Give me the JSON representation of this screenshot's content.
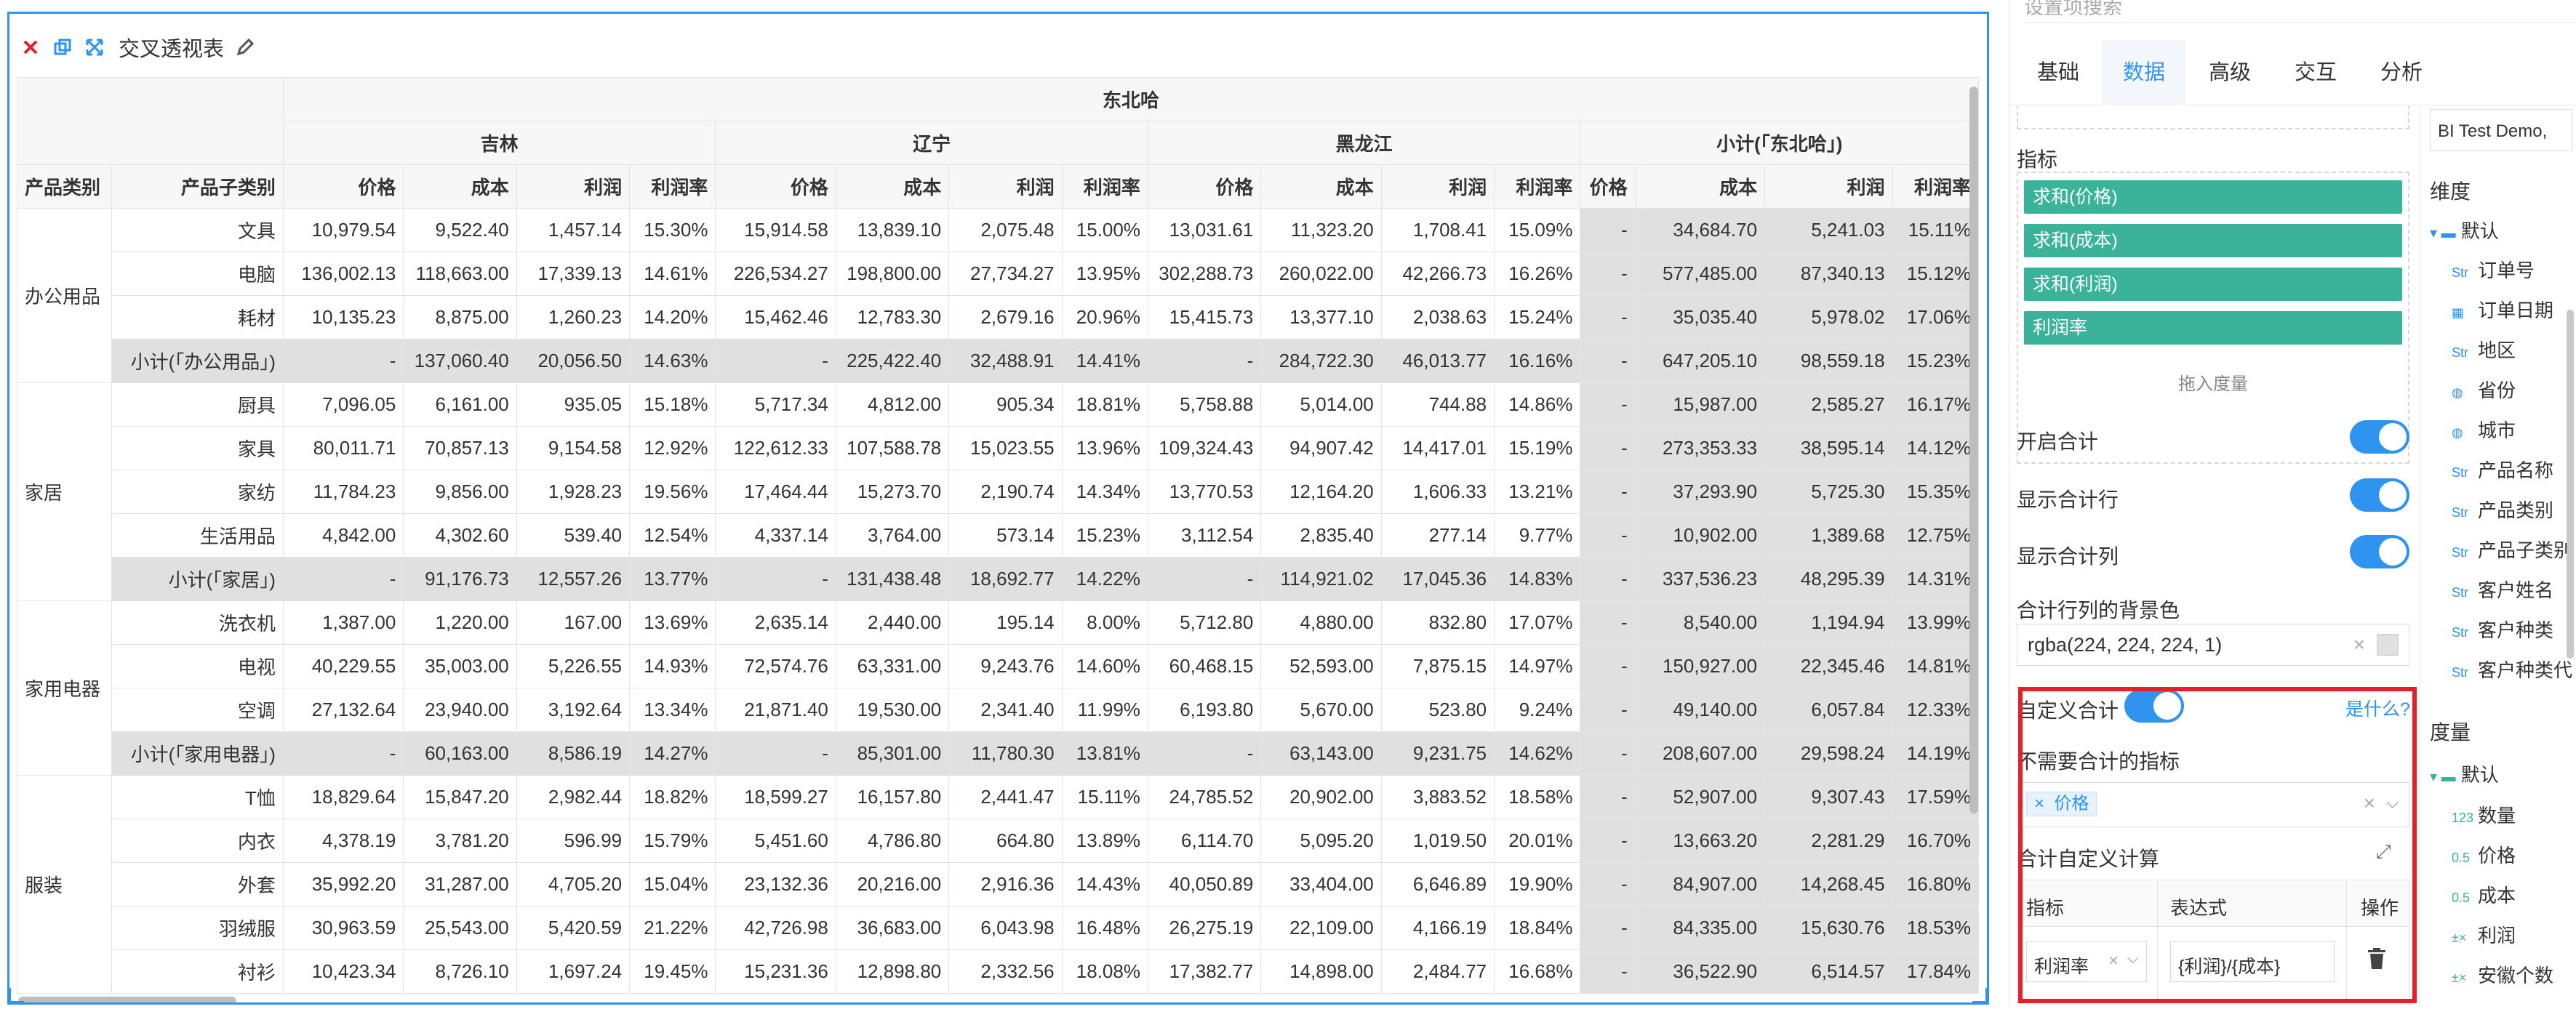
{
  "widget": {
    "title": "交叉透视表",
    "header": {
      "region": "东北哈",
      "provinces": [
        "吉林",
        "辽宁",
        "黑龙江",
        "小计(「东北哈」)"
      ],
      "row_dims": [
        "产品类别",
        "产品子类别"
      ],
      "metrics": [
        "价格",
        "成本",
        "利润",
        "利润率"
      ]
    },
    "rows": [
      {
        "cat": "办公用品",
        "sub": "文具",
        "v": [
          "10,979.54",
          "9,522.40",
          "1,457.14",
          "15.30%",
          "15,914.58",
          "13,839.10",
          "2,075.48",
          "15.00%",
          "13,031.61",
          "11,323.20",
          "1,708.41",
          "15.09%",
          "-",
          "34,684.70",
          "5,241.03",
          "15.11%"
        ]
      },
      {
        "cat": "",
        "sub": "电脑",
        "v": [
          "136,002.13",
          "118,663.00",
          "17,339.13",
          "14.61%",
          "226,534.27",
          "198,800.00",
          "27,734.27",
          "13.95%",
          "302,288.73",
          "260,022.00",
          "42,266.73",
          "16.26%",
          "-",
          "577,485.00",
          "87,340.13",
          "15.12%"
        ]
      },
      {
        "cat": "",
        "sub": "耗材",
        "v": [
          "10,135.23",
          "8,875.00",
          "1,260.23",
          "14.20%",
          "15,462.46",
          "12,783.30",
          "2,679.16",
          "20.96%",
          "15,415.73",
          "13,377.10",
          "2,038.63",
          "15.24%",
          "-",
          "35,035.40",
          "5,978.02",
          "17.06%"
        ]
      },
      {
        "cat": "",
        "sub": "小计(「办公用品」)",
        "subtotal": true,
        "v": [
          "-",
          "137,060.40",
          "20,056.50",
          "14.63%",
          "-",
          "225,422.40",
          "32,488.91",
          "14.41%",
          "-",
          "284,722.30",
          "46,013.77",
          "16.16%",
          "-",
          "647,205.10",
          "98,559.18",
          "15.23%"
        ]
      },
      {
        "cat": "家居",
        "sub": "厨具",
        "v": [
          "7,096.05",
          "6,161.00",
          "935.05",
          "15.18%",
          "5,717.34",
          "4,812.00",
          "905.34",
          "18.81%",
          "5,758.88",
          "5,014.00",
          "744.88",
          "14.86%",
          "-",
          "15,987.00",
          "2,585.27",
          "16.17%"
        ]
      },
      {
        "cat": "",
        "sub": "家具",
        "v": [
          "80,011.71",
          "70,857.13",
          "9,154.58",
          "12.92%",
          "122,612.33",
          "107,588.78",
          "15,023.55",
          "13.96%",
          "109,324.43",
          "94,907.42",
          "14,417.01",
          "15.19%",
          "-",
          "273,353.33",
          "38,595.14",
          "14.12%"
        ]
      },
      {
        "cat": "",
        "sub": "家纺",
        "v": [
          "11,784.23",
          "9,856.00",
          "1,928.23",
          "19.56%",
          "17,464.44",
          "15,273.70",
          "2,190.74",
          "14.34%",
          "13,770.53",
          "12,164.20",
          "1,606.33",
          "13.21%",
          "-",
          "37,293.90",
          "5,725.30",
          "15.35%"
        ]
      },
      {
        "cat": "",
        "sub": "生活用品",
        "v": [
          "4,842.00",
          "4,302.60",
          "539.40",
          "12.54%",
          "4,337.14",
          "3,764.00",
          "573.14",
          "15.23%",
          "3,112.54",
          "2,835.40",
          "277.14",
          "9.77%",
          "-",
          "10,902.00",
          "1,389.68",
          "12.75%"
        ]
      },
      {
        "cat": "",
        "sub": "小计(「家居」)",
        "subtotal": true,
        "v": [
          "-",
          "91,176.73",
          "12,557.26",
          "13.77%",
          "-",
          "131,438.48",
          "18,692.77",
          "14.22%",
          "-",
          "114,921.02",
          "17,045.36",
          "14.83%",
          "-",
          "337,536.23",
          "48,295.39",
          "14.31%"
        ]
      },
      {
        "cat": "家用电器",
        "sub": "洗衣机",
        "v": [
          "1,387.00",
          "1,220.00",
          "167.00",
          "13.69%",
          "2,635.14",
          "2,440.00",
          "195.14",
          "8.00%",
          "5,712.80",
          "4,880.00",
          "832.80",
          "17.07%",
          "-",
          "8,540.00",
          "1,194.94",
          "13.99%"
        ]
      },
      {
        "cat": "",
        "sub": "电视",
        "v": [
          "40,229.55",
          "35,003.00",
          "5,226.55",
          "14.93%",
          "72,574.76",
          "63,331.00",
          "9,243.76",
          "14.60%",
          "60,468.15",
          "52,593.00",
          "7,875.15",
          "14.97%",
          "-",
          "150,927.00",
          "22,345.46",
          "14.81%"
        ]
      },
      {
        "cat": "",
        "sub": "空调",
        "v": [
          "27,132.64",
          "23,940.00",
          "3,192.64",
          "13.34%",
          "21,871.40",
          "19,530.00",
          "2,341.40",
          "11.99%",
          "6,193.80",
          "5,670.00",
          "523.80",
          "9.24%",
          "-",
          "49,140.00",
          "6,057.84",
          "12.33%"
        ]
      },
      {
        "cat": "",
        "sub": "小计(「家用电器」)",
        "subtotal": true,
        "v": [
          "-",
          "60,163.00",
          "8,586.19",
          "14.27%",
          "-",
          "85,301.00",
          "11,780.30",
          "13.81%",
          "-",
          "63,143.00",
          "9,231.75",
          "14.62%",
          "-",
          "208,607.00",
          "29,598.24",
          "14.19%"
        ]
      },
      {
        "cat": "服装",
        "sub": "T恤",
        "v": [
          "18,829.64",
          "15,847.20",
          "2,982.44",
          "18.82%",
          "18,599.27",
          "16,157.80",
          "2,441.47",
          "15.11%",
          "24,785.52",
          "20,902.00",
          "3,883.52",
          "18.58%",
          "-",
          "52,907.00",
          "9,307.43",
          "17.59%"
        ]
      },
      {
        "cat": "",
        "sub": "内衣",
        "v": [
          "4,378.19",
          "3,781.20",
          "596.99",
          "15.79%",
          "5,451.60",
          "4,786.80",
          "664.80",
          "13.89%",
          "6,114.70",
          "5,095.20",
          "1,019.50",
          "20.01%",
          "-",
          "13,663.20",
          "2,281.29",
          "16.70%"
        ]
      },
      {
        "cat": "",
        "sub": "外套",
        "v": [
          "35,992.20",
          "31,287.00",
          "4,705.20",
          "15.04%",
          "23,132.36",
          "20,216.00",
          "2,916.36",
          "14.43%",
          "40,050.89",
          "33,404.00",
          "6,646.89",
          "19.90%",
          "-",
          "84,907.00",
          "14,268.45",
          "16.80%"
        ]
      },
      {
        "cat": "",
        "sub": "羽绒服",
        "v": [
          "30,963.59",
          "25,543.00",
          "5,420.59",
          "21.22%",
          "42,726.98",
          "36,683.00",
          "6,043.98",
          "16.48%",
          "26,275.19",
          "22,109.00",
          "4,166.19",
          "18.84%",
          "-",
          "84,335.00",
          "15,630.76",
          "18.53%"
        ]
      },
      {
        "cat": "",
        "sub": "衬衫",
        "v": [
          "10,423.34",
          "8,726.10",
          "1,697.24",
          "19.45%",
          "15,231.36",
          "12,898.80",
          "2,332.56",
          "18.08%",
          "17,382.77",
          "14,898.00",
          "2,484.77",
          "16.68%",
          "-",
          "36,522.90",
          "6,514.57",
          "17.84%"
        ]
      }
    ]
  },
  "settings": {
    "search_placeholder": "设置项搜索",
    "tabs": [
      "基础",
      "数据",
      "高级",
      "交互",
      "分析"
    ],
    "active_tab": "数据",
    "measure_label": "指标",
    "measures": [
      "求和(价格)",
      "求和(成本)",
      "求和(利润)",
      "利润率"
    ],
    "drop_hint": "拖入度量",
    "toggle_total": "开启合计",
    "toggle_total_row": "显示合计行",
    "toggle_total_col": "显示合计列",
    "bg_label": "合计行列的背景色",
    "bg_value": "rgba(224, 224, 224, 1)",
    "custom_total": "自定义合计",
    "what_is": "是什么?",
    "exclude_label": "不需要合计的指标",
    "exclude_tag": "价格",
    "calc_label": "合计自定义计算",
    "calc_cols": [
      "指标",
      "表达式",
      "操作"
    ],
    "calc_metric": "利润率",
    "calc_expr": "{利润}/{成本}",
    "accent": "#2f93f0",
    "pill_color": "#3bb39a"
  },
  "fields": {
    "dataset": "BI Test Demo,",
    "dim_title": "维度",
    "dim_folder": "默认",
    "dims": [
      {
        "icon": "Str",
        "label": "订单号"
      },
      {
        "icon": "date",
        "label": "订单日期"
      },
      {
        "icon": "Str",
        "label": "地区"
      },
      {
        "icon": "geo",
        "label": "省份"
      },
      {
        "icon": "geo",
        "label": "城市"
      },
      {
        "icon": "Str",
        "label": "产品名称"
      },
      {
        "icon": "Str",
        "label": "产品类别"
      },
      {
        "icon": "Str",
        "label": "产品子类别"
      },
      {
        "icon": "Str",
        "label": "客户姓名"
      },
      {
        "icon": "Str",
        "label": "客户种类"
      },
      {
        "icon": "Str",
        "label": "客户种类代"
      }
    ],
    "measure_title": "度量",
    "measure_folder": "默认",
    "meas": [
      {
        "icon": "123",
        "label": "数量"
      },
      {
        "icon": "0.5",
        "label": "价格"
      },
      {
        "icon": "0.5",
        "label": "成本"
      },
      {
        "icon": "calc",
        "label": "利润"
      },
      {
        "icon": "calc",
        "label": "安徽个数"
      }
    ]
  }
}
